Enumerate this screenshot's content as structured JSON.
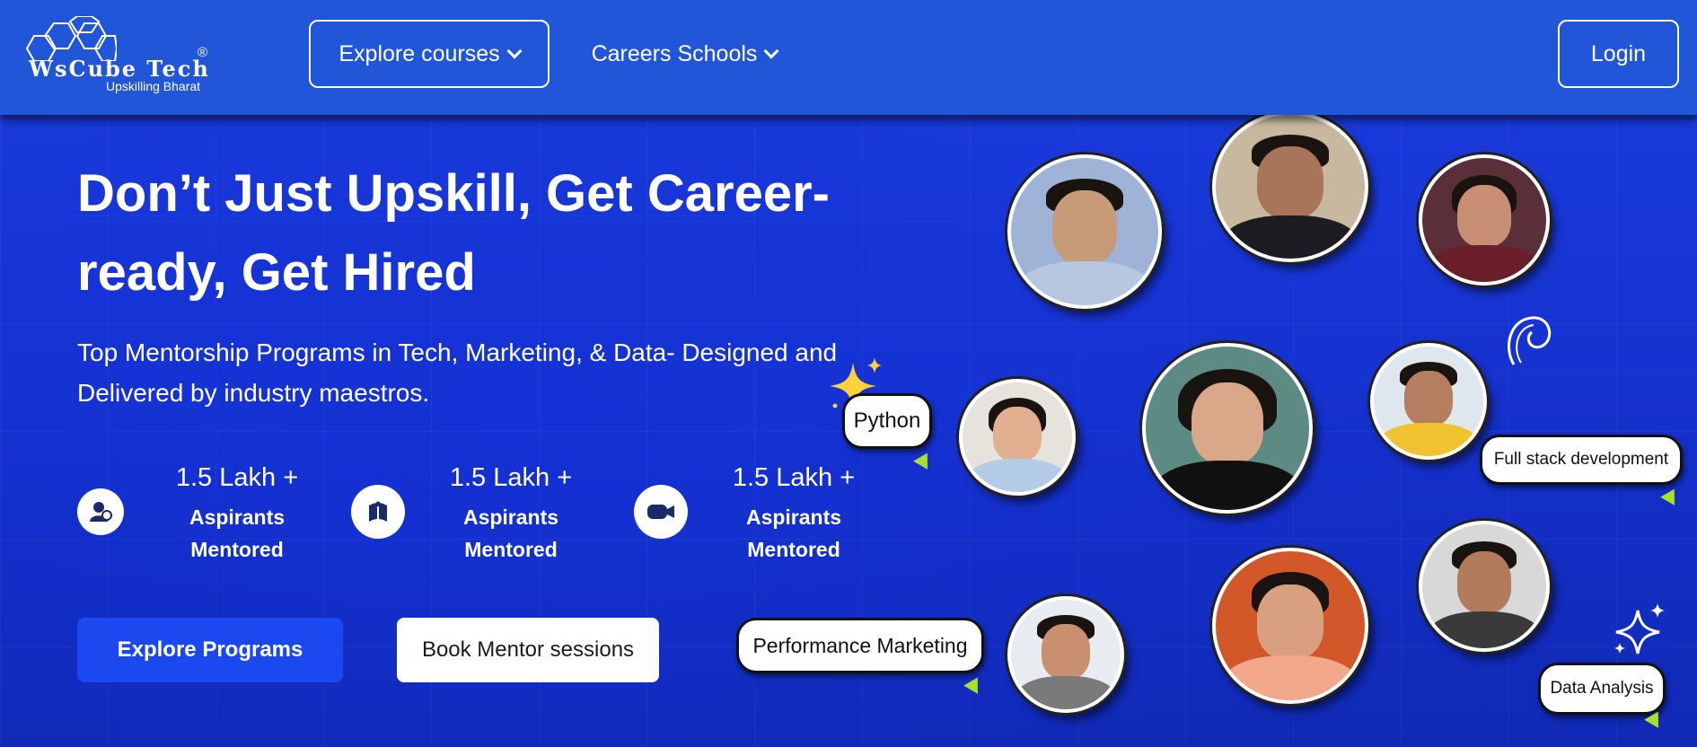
{
  "brand": {
    "name": "WsCube Tech",
    "registered": "®",
    "tagline": "Upskilling Bharat"
  },
  "nav": {
    "explore_label": "Explore courses",
    "careers_label": "Careers Schools",
    "login_label": "Login"
  },
  "hero": {
    "headline": "Don’t Just Upskill, Get Career-ready, Get Hired",
    "subline": "Top Mentorship Programs in Tech, Marketing, & Data- Designed and Delivered by industry maestros.",
    "stats": [
      {
        "number": "1.5 Lakh +",
        "label": "Aspirants Mentored",
        "icon": "users-icon"
      },
      {
        "number": "1.5 Lakh +",
        "label": "Aspirants Mentored",
        "icon": "book-icon"
      },
      {
        "number": "1.5 Lakh +",
        "label": "Aspirants Mentored",
        "icon": "video-icon"
      }
    ],
    "primary_cta": "Explore Programs",
    "secondary_cta": "Book Mentor sessions"
  },
  "tags": {
    "python": "Python",
    "fullstack": "Full stack development",
    "marketing": "Performance Marketing",
    "data": "Data Analysis"
  },
  "colors": {
    "header_bg": "#2256d9",
    "hero_bg": "#1632cf",
    "primary_button": "#1c48f0",
    "pointer_green": "#a8e02a",
    "sparkle_yellow": "#ffd23c"
  }
}
